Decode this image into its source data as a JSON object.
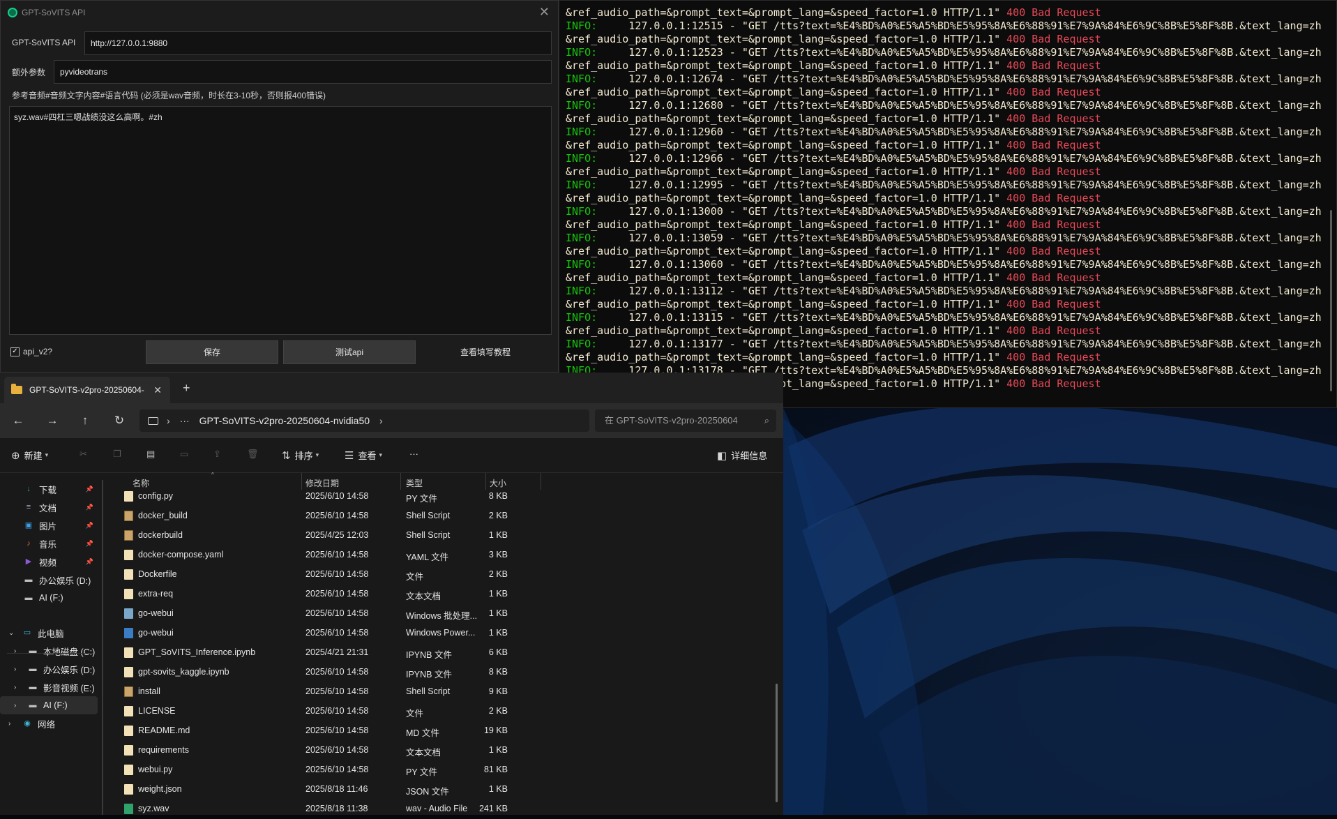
{
  "terminal": {
    "lines": [
      {
        "kind": "cont",
        "text": "&ref_audio_path=&prompt_text=&prompt_lang=&speed_factor=1.0 HTTP/1.1\"",
        "status": "400 Bad Request"
      },
      {
        "kind": "info",
        "prefix": "INFO:",
        "text": "     127.0.0.1:12515 - \"GET /tts?text=%E4%BD%A0%E5%A5%BD%E5%95%8A%E6%88%91%E7%9A%84%E6%9C%8B%E5%8F%8B.&text_lang=zh"
      },
      {
        "kind": "cont",
        "text": "&ref_audio_path=&prompt_text=&prompt_lang=&speed_factor=1.0 HTTP/1.1\"",
        "status": "400 Bad Request"
      },
      {
        "kind": "info",
        "prefix": "INFO:",
        "text": "     127.0.0.1:12523 - \"GET /tts?text=%E4%BD%A0%E5%A5%BD%E5%95%8A%E6%88%91%E7%9A%84%E6%9C%8B%E5%8F%8B.&text_lang=zh"
      },
      {
        "kind": "cont",
        "text": "&ref_audio_path=&prompt_text=&prompt_lang=&speed_factor=1.0 HTTP/1.1\"",
        "status": "400 Bad Request"
      },
      {
        "kind": "info",
        "prefix": "INFO:",
        "text": "     127.0.0.1:12674 - \"GET /tts?text=%E4%BD%A0%E5%A5%BD%E5%95%8A%E6%88%91%E7%9A%84%E6%9C%8B%E5%8F%8B.&text_lang=zh"
      },
      {
        "kind": "cont",
        "text": "&ref_audio_path=&prompt_text=&prompt_lang=&speed_factor=1.0 HTTP/1.1\"",
        "status": "400 Bad Request"
      },
      {
        "kind": "info",
        "prefix": "INFO:",
        "text": "     127.0.0.1:12680 - \"GET /tts?text=%E4%BD%A0%E5%A5%BD%E5%95%8A%E6%88%91%E7%9A%84%E6%9C%8B%E5%8F%8B.&text_lang=zh"
      },
      {
        "kind": "cont",
        "text": "&ref_audio_path=&prompt_text=&prompt_lang=&speed_factor=1.0 HTTP/1.1\"",
        "status": "400 Bad Request"
      },
      {
        "kind": "info",
        "prefix": "INFO:",
        "text": "     127.0.0.1:12960 - \"GET /tts?text=%E4%BD%A0%E5%A5%BD%E5%95%8A%E6%88%91%E7%9A%84%E6%9C%8B%E5%8F%8B.&text_lang=zh"
      },
      {
        "kind": "cont",
        "text": "&ref_audio_path=&prompt_text=&prompt_lang=&speed_factor=1.0 HTTP/1.1\"",
        "status": "400 Bad Request"
      },
      {
        "kind": "info",
        "prefix": "INFO:",
        "text": "     127.0.0.1:12966 - \"GET /tts?text=%E4%BD%A0%E5%A5%BD%E5%95%8A%E6%88%91%E7%9A%84%E6%9C%8B%E5%8F%8B.&text_lang=zh"
      },
      {
        "kind": "cont",
        "text": "&ref_audio_path=&prompt_text=&prompt_lang=&speed_factor=1.0 HTTP/1.1\"",
        "status": "400 Bad Request"
      },
      {
        "kind": "info",
        "prefix": "INFO:",
        "text": "     127.0.0.1:12995 - \"GET /tts?text=%E4%BD%A0%E5%A5%BD%E5%95%8A%E6%88%91%E7%9A%84%E6%9C%8B%E5%8F%8B.&text_lang=zh"
      },
      {
        "kind": "cont",
        "text": "&ref_audio_path=&prompt_text=&prompt_lang=&speed_factor=1.0 HTTP/1.1\"",
        "status": "400 Bad Request"
      },
      {
        "kind": "info",
        "prefix": "INFO:",
        "text": "     127.0.0.1:13000 - \"GET /tts?text=%E4%BD%A0%E5%A5%BD%E5%95%8A%E6%88%91%E7%9A%84%E6%9C%8B%E5%8F%8B.&text_lang=zh"
      },
      {
        "kind": "cont",
        "text": "&ref_audio_path=&prompt_text=&prompt_lang=&speed_factor=1.0 HTTP/1.1\"",
        "status": "400 Bad Request"
      },
      {
        "kind": "info",
        "prefix": "INFO:",
        "text": "     127.0.0.1:13059 - \"GET /tts?text=%E4%BD%A0%E5%A5%BD%E5%95%8A%E6%88%91%E7%9A%84%E6%9C%8B%E5%8F%8B.&text_lang=zh"
      },
      {
        "kind": "cont",
        "text": "&ref_audio_path=&prompt_text=&prompt_lang=&speed_factor=1.0 HTTP/1.1\"",
        "status": "400 Bad Request"
      },
      {
        "kind": "info",
        "prefix": "INFO:",
        "text": "     127.0.0.1:13060 - \"GET /tts?text=%E4%BD%A0%E5%A5%BD%E5%95%8A%E6%88%91%E7%9A%84%E6%9C%8B%E5%8F%8B.&text_lang=zh"
      },
      {
        "kind": "cont",
        "text": "&ref_audio_path=&prompt_text=&prompt_lang=&speed_factor=1.0 HTTP/1.1\"",
        "status": "400 Bad Request"
      },
      {
        "kind": "info",
        "prefix": "INFO:",
        "text": "     127.0.0.1:13112 - \"GET /tts?text=%E4%BD%A0%E5%A5%BD%E5%95%8A%E6%88%91%E7%9A%84%E6%9C%8B%E5%8F%8B.&text_lang=zh"
      },
      {
        "kind": "cont",
        "text": "&ref_audio_path=&prompt_text=&prompt_lang=&speed_factor=1.0 HTTP/1.1\"",
        "status": "400 Bad Request"
      },
      {
        "kind": "info",
        "prefix": "INFO:",
        "text": "     127.0.0.1:13115 - \"GET /tts?text=%E4%BD%A0%E5%A5%BD%E5%95%8A%E6%88%91%E7%9A%84%E6%9C%8B%E5%8F%8B.&text_lang=zh"
      },
      {
        "kind": "cont",
        "text": "&ref_audio_path=&prompt_text=&prompt_lang=&speed_factor=1.0 HTTP/1.1\"",
        "status": "400 Bad Request"
      },
      {
        "kind": "info",
        "prefix": "INFO:",
        "text": "     127.0.0.1:13177 - \"GET /tts?text=%E4%BD%A0%E5%A5%BD%E5%95%8A%E6%88%91%E7%9A%84%E6%9C%8B%E5%8F%8B.&text_lang=zh"
      },
      {
        "kind": "cont",
        "text": "&ref_audio_path=&prompt_text=&prompt_lang=&speed_factor=1.0 HTTP/1.1\"",
        "status": "400 Bad Request"
      },
      {
        "kind": "info",
        "prefix": "INFO:",
        "text": "     127.0.0.1:13178 - \"GET /tts?text=%E4%BD%A0%E5%A5%BD%E5%95%8A%E6%88%91%E7%9A%84%E6%9C%8B%E5%8F%8B.&text_lang=zh"
      },
      {
        "kind": "cont",
        "text": "&ref_audio_path=&prompt_text=&prompt_lang=&speed_factor=1.0 HTTP/1.1\"",
        "status": "400 Bad Request"
      }
    ]
  },
  "dialog": {
    "title": "GPT-SoVITS API",
    "close_glyph": "✕",
    "api_label": "GPT-SoVITS API",
    "api_value": "http://127.0.0.1:9880",
    "extra_label": "额外参数",
    "extra_value": "pyvideotrans",
    "hint": "参考音频#音频文字内容#语言代码 (必须是wav音频，时长在3-10秒，否则报400错误)",
    "ref_text": "syz.wav#四杠三嗯战绩没这么高啊。#zh",
    "apiv2_label": "api_v2?",
    "apiv2_checked": "✓",
    "save_label": "保存",
    "test_label": "测试api",
    "tutorial_label": "查看填写教程"
  },
  "explorer": {
    "tab_label": "GPT-SoVITS-v2pro-20250604-",
    "tab_close": "✕",
    "new_tab": "+",
    "nav": {
      "back": "←",
      "forward": "→",
      "up": "↑",
      "refresh": "↻"
    },
    "address": {
      "dots": "···",
      "path": "GPT-SoVITS-v2pro-20250604-nvidia50",
      "chev": "›"
    },
    "search_placeholder": "在 GPT-SoVITS-v2pro-20250604",
    "commands": {
      "new": "新建",
      "sort": "排序",
      "view": "查看",
      "more": "···",
      "details": "详细信息"
    },
    "sidebar": [
      {
        "label": "下载",
        "icon": "download-icon",
        "pinned": true
      },
      {
        "label": "文档",
        "icon": "documents-icon",
        "pinned": true
      },
      {
        "label": "图片",
        "icon": "pictures-icon",
        "pinned": true
      },
      {
        "label": "音乐",
        "icon": "music-icon",
        "pinned": true
      },
      {
        "label": "视频",
        "icon": "videos-icon",
        "pinned": true
      },
      {
        "label": "办公娱乐 (D:)",
        "icon": "drive-icon",
        "pinned": false
      },
      {
        "label": "AI (F:)",
        "icon": "drive-icon",
        "pinned": false
      },
      {
        "label": "此电脑",
        "icon": "this-pc-icon",
        "pinned": false
      },
      {
        "label": "本地磁盘 (C:)",
        "icon": "drive-icon",
        "pinned": false
      },
      {
        "label": "办公娱乐 (D:)",
        "icon": "drive-icon",
        "pinned": false
      },
      {
        "label": "影音视频 (E:)",
        "icon": "drive-icon",
        "pinned": false
      },
      {
        "label": "AI (F:)",
        "icon": "drive-icon",
        "pinned": false
      },
      {
        "label": "网络",
        "icon": "network-icon",
        "pinned": false
      }
    ],
    "columns": [
      "名称",
      "修改日期",
      "类型",
      "大小"
    ],
    "files": [
      {
        "name": "config.py",
        "date": "2025/6/10 14:58",
        "type": "PY 文件",
        "size": "8 KB",
        "icon": "doc"
      },
      {
        "name": "docker_build",
        "date": "2025/6/10 14:58",
        "type": "Shell Script",
        "size": "2 KB",
        "icon": "sh"
      },
      {
        "name": "dockerbuild",
        "date": "2025/4/25 12:03",
        "type": "Shell Script",
        "size": "1 KB",
        "icon": "sh"
      },
      {
        "name": "docker-compose.yaml",
        "date": "2025/6/10 14:58",
        "type": "YAML 文件",
        "size": "3 KB",
        "icon": "doc"
      },
      {
        "name": "Dockerfile",
        "date": "2025/6/10 14:58",
        "type": "文件",
        "size": "2 KB",
        "icon": "doc"
      },
      {
        "name": "extra-req",
        "date": "2025/6/10 14:58",
        "type": "文本文档",
        "size": "1 KB",
        "icon": "doc"
      },
      {
        "name": "go-webui",
        "date": "2025/6/10 14:58",
        "type": "Windows 批处理...",
        "size": "1 KB",
        "icon": "bat"
      },
      {
        "name": "go-webui",
        "date": "2025/6/10 14:58",
        "type": "Windows Power...",
        "size": "1 KB",
        "icon": "ps"
      },
      {
        "name": "GPT_SoVITS_Inference.ipynb",
        "date": "2025/4/21 21:31",
        "type": "IPYNB 文件",
        "size": "6 KB",
        "icon": "doc"
      },
      {
        "name": "gpt-sovits_kaggle.ipynb",
        "date": "2025/6/10 14:58",
        "type": "IPYNB 文件",
        "size": "8 KB",
        "icon": "doc"
      },
      {
        "name": "install",
        "date": "2025/6/10 14:58",
        "type": "Shell Script",
        "size": "9 KB",
        "icon": "sh"
      },
      {
        "name": "LICENSE",
        "date": "2025/6/10 14:58",
        "type": "文件",
        "size": "2 KB",
        "icon": "doc"
      },
      {
        "name": "README.md",
        "date": "2025/6/10 14:58",
        "type": "MD 文件",
        "size": "19 KB",
        "icon": "doc"
      },
      {
        "name": "requirements",
        "date": "2025/6/10 14:58",
        "type": "文本文档",
        "size": "1 KB",
        "icon": "doc"
      },
      {
        "name": "webui.py",
        "date": "2025/6/10 14:58",
        "type": "PY 文件",
        "size": "81 KB",
        "icon": "doc"
      },
      {
        "name": "weight.json",
        "date": "2025/8/18 11:46",
        "type": "JSON 文件",
        "size": "1 KB",
        "icon": "doc"
      },
      {
        "name": "syz.wav",
        "date": "2025/8/18 11:38",
        "type": "wav - Audio File",
        "size": "241 KB",
        "icon": "wav"
      }
    ]
  },
  "colors": {
    "terminal_info": "#16c60c",
    "terminal_text": "#f2e9d0",
    "terminal_error": "#e74856",
    "folder": "#e8b13c"
  }
}
